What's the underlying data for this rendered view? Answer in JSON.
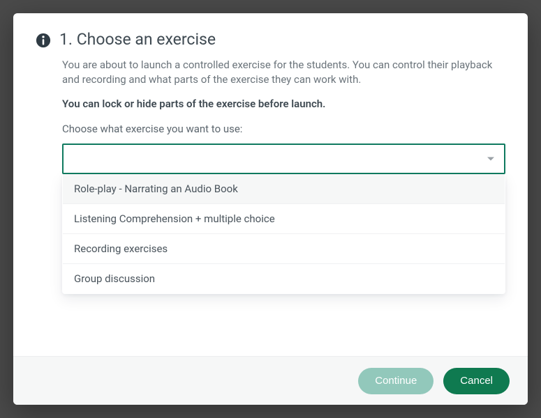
{
  "header": {
    "title": "1. Choose an exercise",
    "description": "You are about to launch a controlled exercise for the students. You can control their playback and recording and what parts of the exercise they can work with.",
    "bold_line": "You can lock or hide parts of the exercise before launch.",
    "label": "Choose what exercise you want to use:"
  },
  "select": {
    "value": "",
    "options": [
      "Role-play - Narrating an Audio Book",
      "Listening Comprehension + multiple choice",
      "Recording exercises",
      "Group discussion"
    ]
  },
  "footer": {
    "continue_label": "Continue",
    "cancel_label": "Cancel"
  },
  "icons": {
    "info": "info-circle-icon",
    "caret": "caret-down-icon"
  }
}
